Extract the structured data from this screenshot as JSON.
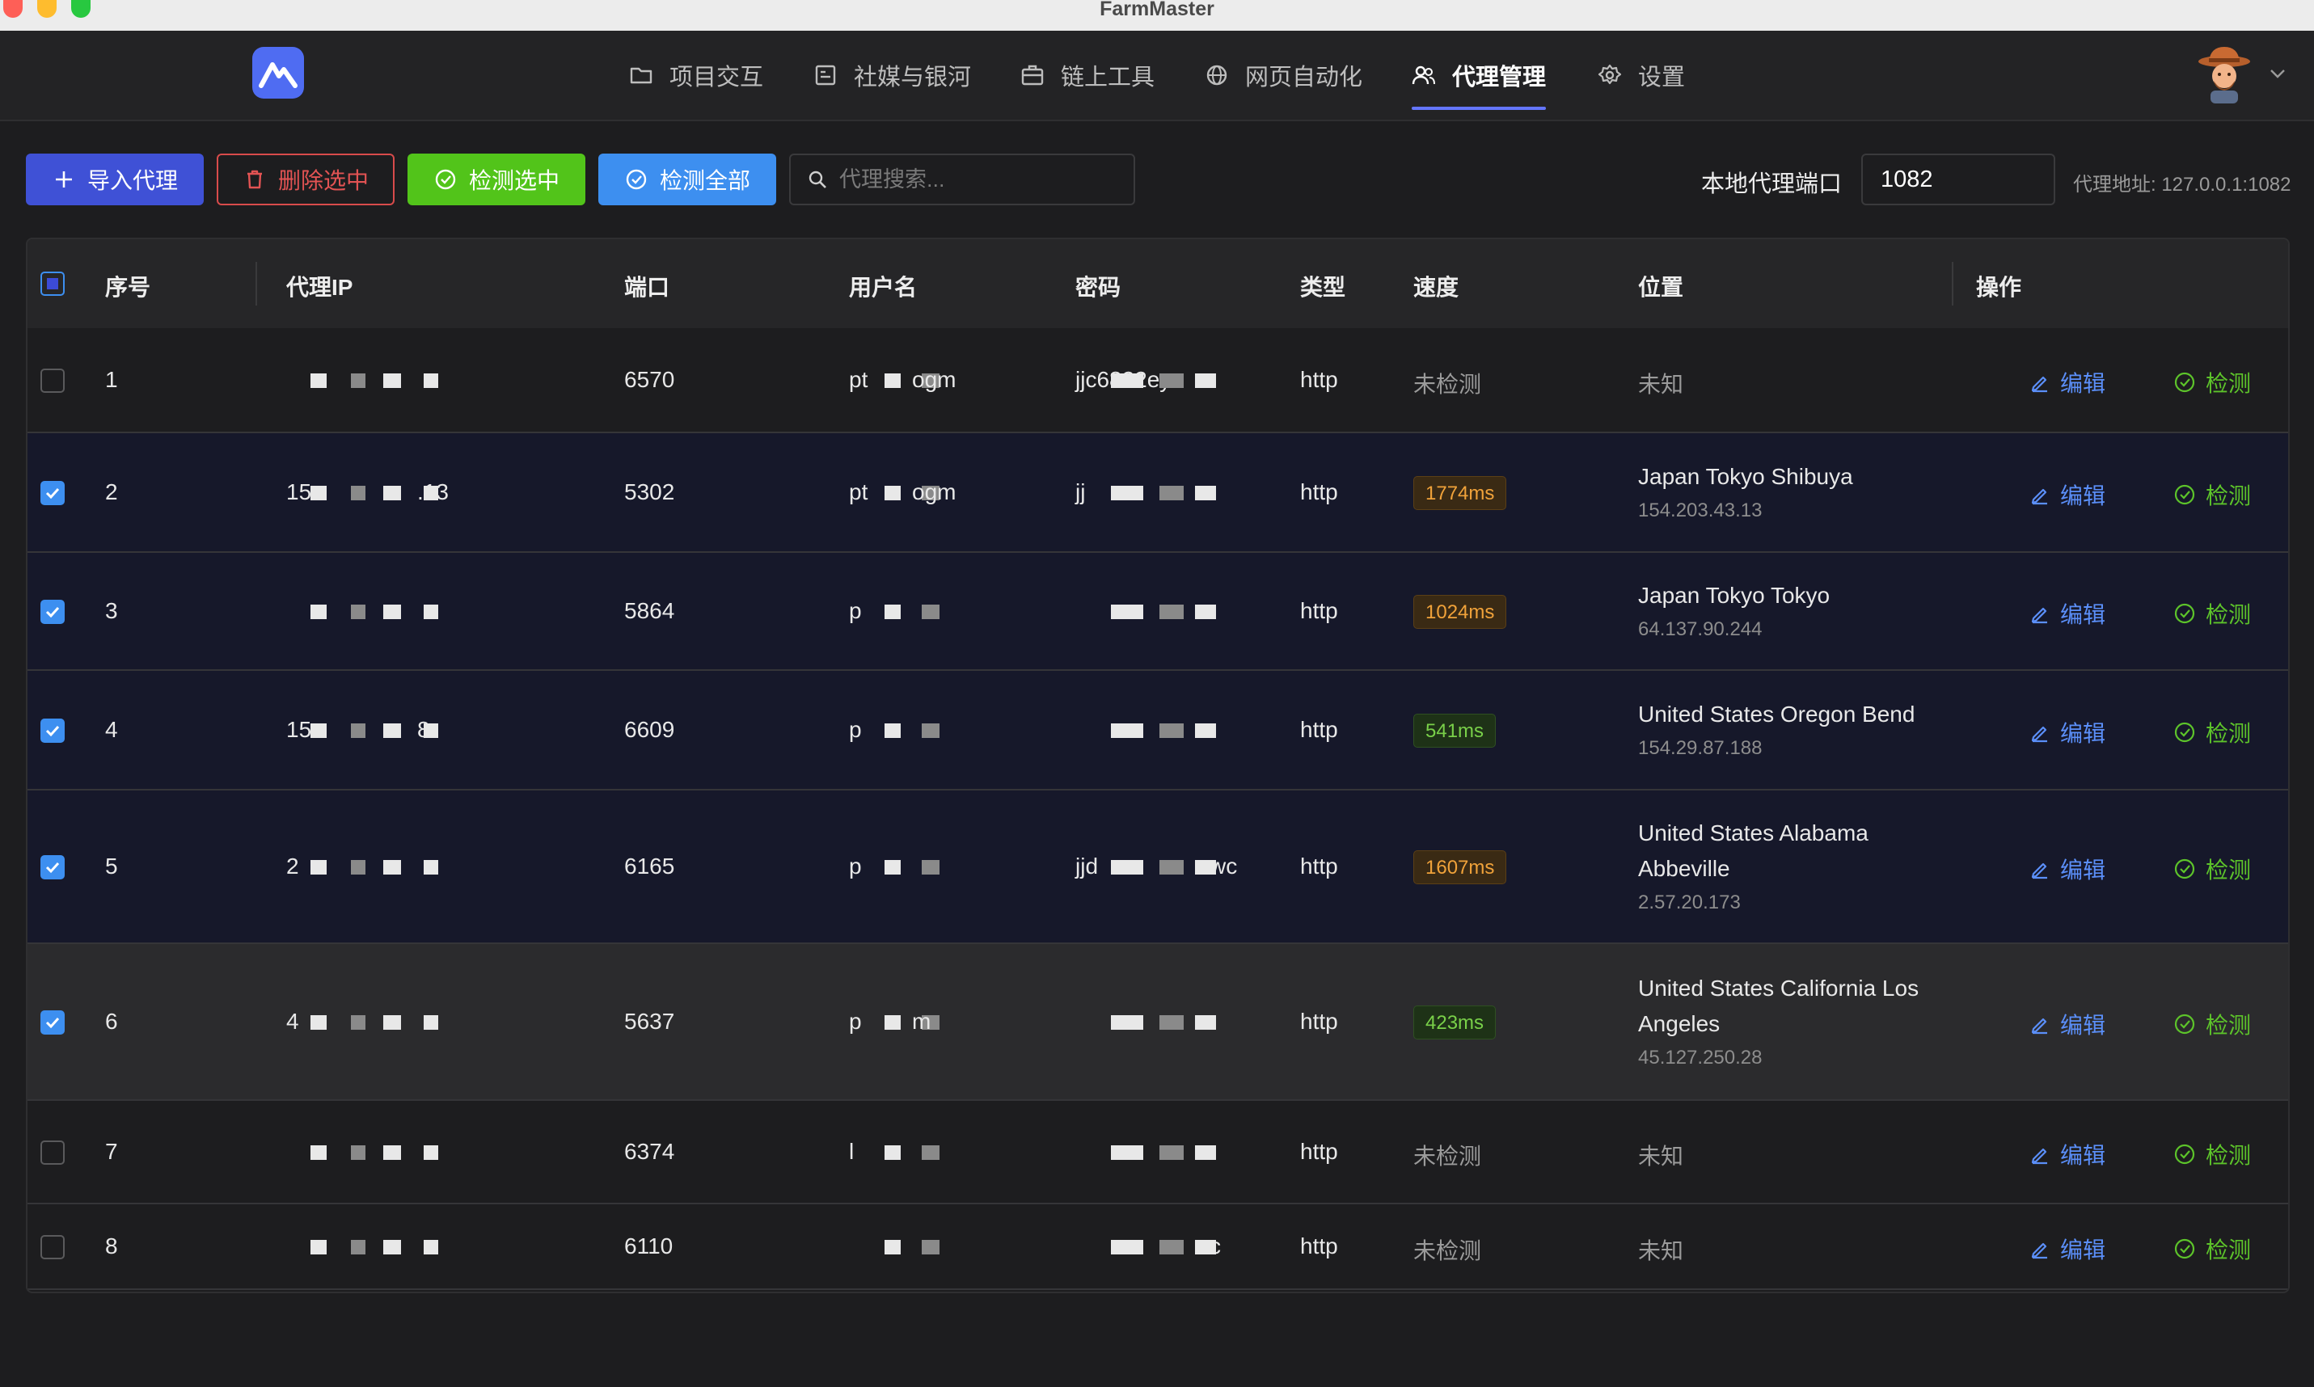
{
  "window": {
    "title": "FarmMaster"
  },
  "nav": {
    "items": [
      {
        "label": "项目交互",
        "icon": "folder-icon"
      },
      {
        "label": "社媒与银河",
        "icon": "id-card-icon"
      },
      {
        "label": "链上工具",
        "icon": "briefcase-icon"
      },
      {
        "label": "网页自动化",
        "icon": "globe-icon"
      },
      {
        "label": "代理管理",
        "icon": "users-icon",
        "active": true
      },
      {
        "label": "设置",
        "icon": "gear-icon"
      }
    ]
  },
  "toolbar": {
    "import_label": "导入代理",
    "delete_label": "删除选中",
    "check_selected_label": "检测选中",
    "check_all_label": "检测全部",
    "search_placeholder": "代理搜索...",
    "port_label": "本地代理端口",
    "port_value": "1082",
    "proxy_address": "代理地址: 127.0.0.1:1082"
  },
  "table": {
    "columns": [
      "序号",
      "代理IP",
      "端口",
      "用户名",
      "密码",
      "类型",
      "速度",
      "位置",
      "操作"
    ],
    "edit_label": "编辑",
    "check_label": "检测",
    "rows": [
      {
        "index": "1",
        "port": "6570",
        "user_visible": "pt",
        "user_tail": "ogm",
        "pass_visible": "jjc6822eyx",
        "type": "http",
        "speed": "未检测",
        "location": "未知",
        "ip_visible_start": "",
        "ip_visible_end": "",
        "checked": false
      },
      {
        "index": "2",
        "port": "5302",
        "user_visible": "pt",
        "user_tail": "ogm",
        "pass_visible": "jj",
        "type": "http",
        "speed": "1774ms",
        "location": "Japan Tokyo Shibuya",
        "location_ip": "154.203.43.13",
        "ip_visible_start": "15",
        "ip_visible_end": ".13",
        "checked": true
      },
      {
        "index": "3",
        "port": "5864",
        "user_visible": "p",
        "user_tail": "",
        "pass_visible": "",
        "type": "http",
        "speed": "1024ms",
        "location": "Japan Tokyo Tokyo",
        "location_ip": "64.137.90.244",
        "ip_visible_start": "",
        "ip_visible_end": "",
        "checked": true
      },
      {
        "index": "4",
        "port": "6609",
        "user_visible": "p",
        "user_tail": "",
        "pass_visible": "",
        "type": "http",
        "speed": "541ms",
        "location": "United States Oregon Bend",
        "location_ip": "154.29.87.188",
        "ip_visible_start": "15",
        "ip_visible_end": "8",
        "checked": true
      },
      {
        "index": "5",
        "port": "6165",
        "user_visible": "p",
        "user_tail": "",
        "pass_visible": "jjd",
        "pass_tail": "wc",
        "type": "http",
        "speed": "1607ms",
        "location": "United States Alabama Abbeville",
        "location_ip": "2.57.20.173",
        "ip_visible_start": "2",
        "ip_visible_end": "",
        "checked": true
      },
      {
        "index": "6",
        "port": "5637",
        "user_visible": "p",
        "user_tail": "m",
        "pass_visible": "",
        "type": "http",
        "speed": "423ms",
        "location": "United States California Los Angeles",
        "location_ip": "45.127.250.28",
        "ip_visible_start": "4",
        "ip_visible_end": "",
        "checked": true
      },
      {
        "index": "7",
        "port": "6374",
        "user_visible": "l",
        "user_tail": "",
        "pass_visible": "",
        "type": "http",
        "speed": "未检测",
        "location": "未知",
        "ip_visible_start": "",
        "ip_visible_end": "",
        "checked": false
      },
      {
        "index": "8",
        "port": "6110",
        "user_visible": "",
        "user_tail": "",
        "pass_visible": "",
        "pass_tail": "c",
        "type": "http",
        "speed": "未检测",
        "location": "未知",
        "ip_visible_start": "",
        "ip_visible_end": "",
        "checked": false
      }
    ]
  },
  "colors": {
    "accent": "#3f51d6",
    "danger": "#e25353",
    "success": "#52c41a",
    "info": "#3d8ff0",
    "speed_slow": "#f0a23a",
    "speed_fast": "#79d049"
  }
}
